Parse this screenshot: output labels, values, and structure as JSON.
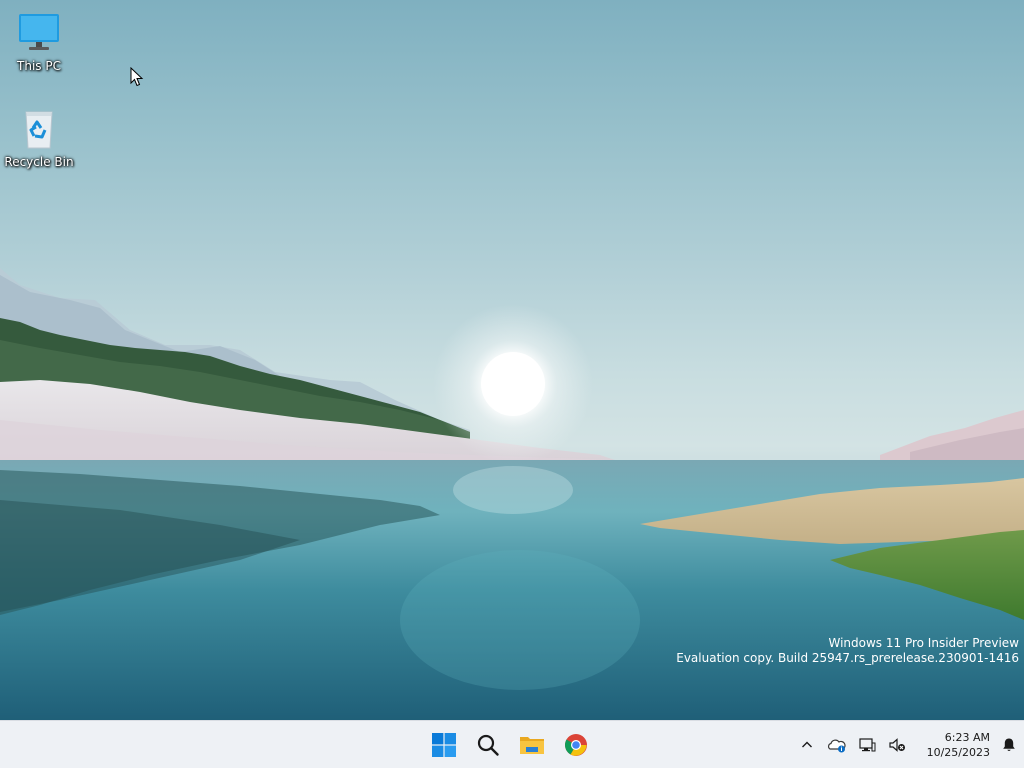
{
  "desktop": {
    "icons": [
      {
        "label": "This PC",
        "icon": "this-pc-icon"
      },
      {
        "label": "Recycle Bin",
        "icon": "recycle-bin-icon"
      }
    ],
    "watermark": {
      "line1": "Windows 11 Pro Insider Preview",
      "line2": "Evaluation copy. Build 25947.rs_prerelease.230901-1416"
    }
  },
  "taskbar": {
    "pinned": [
      {
        "name": "Start",
        "icon": "windows-logo-icon"
      },
      {
        "name": "Search",
        "icon": "search-icon"
      },
      {
        "name": "File Explorer",
        "icon": "folder-icon"
      },
      {
        "name": "Google Chrome",
        "icon": "chrome-icon"
      }
    ],
    "tray": {
      "icons": [
        "chevron-up-icon",
        "onedrive-icon",
        "network-icon",
        "volume-muted-icon",
        "bell-icon"
      ],
      "time": "6:23 AM",
      "date": "10/25/2023"
    }
  },
  "colors": {
    "taskbar_bg": "#eef1f5",
    "start_blue": "#0078d4",
    "folder_yellow": "#f8c440"
  }
}
